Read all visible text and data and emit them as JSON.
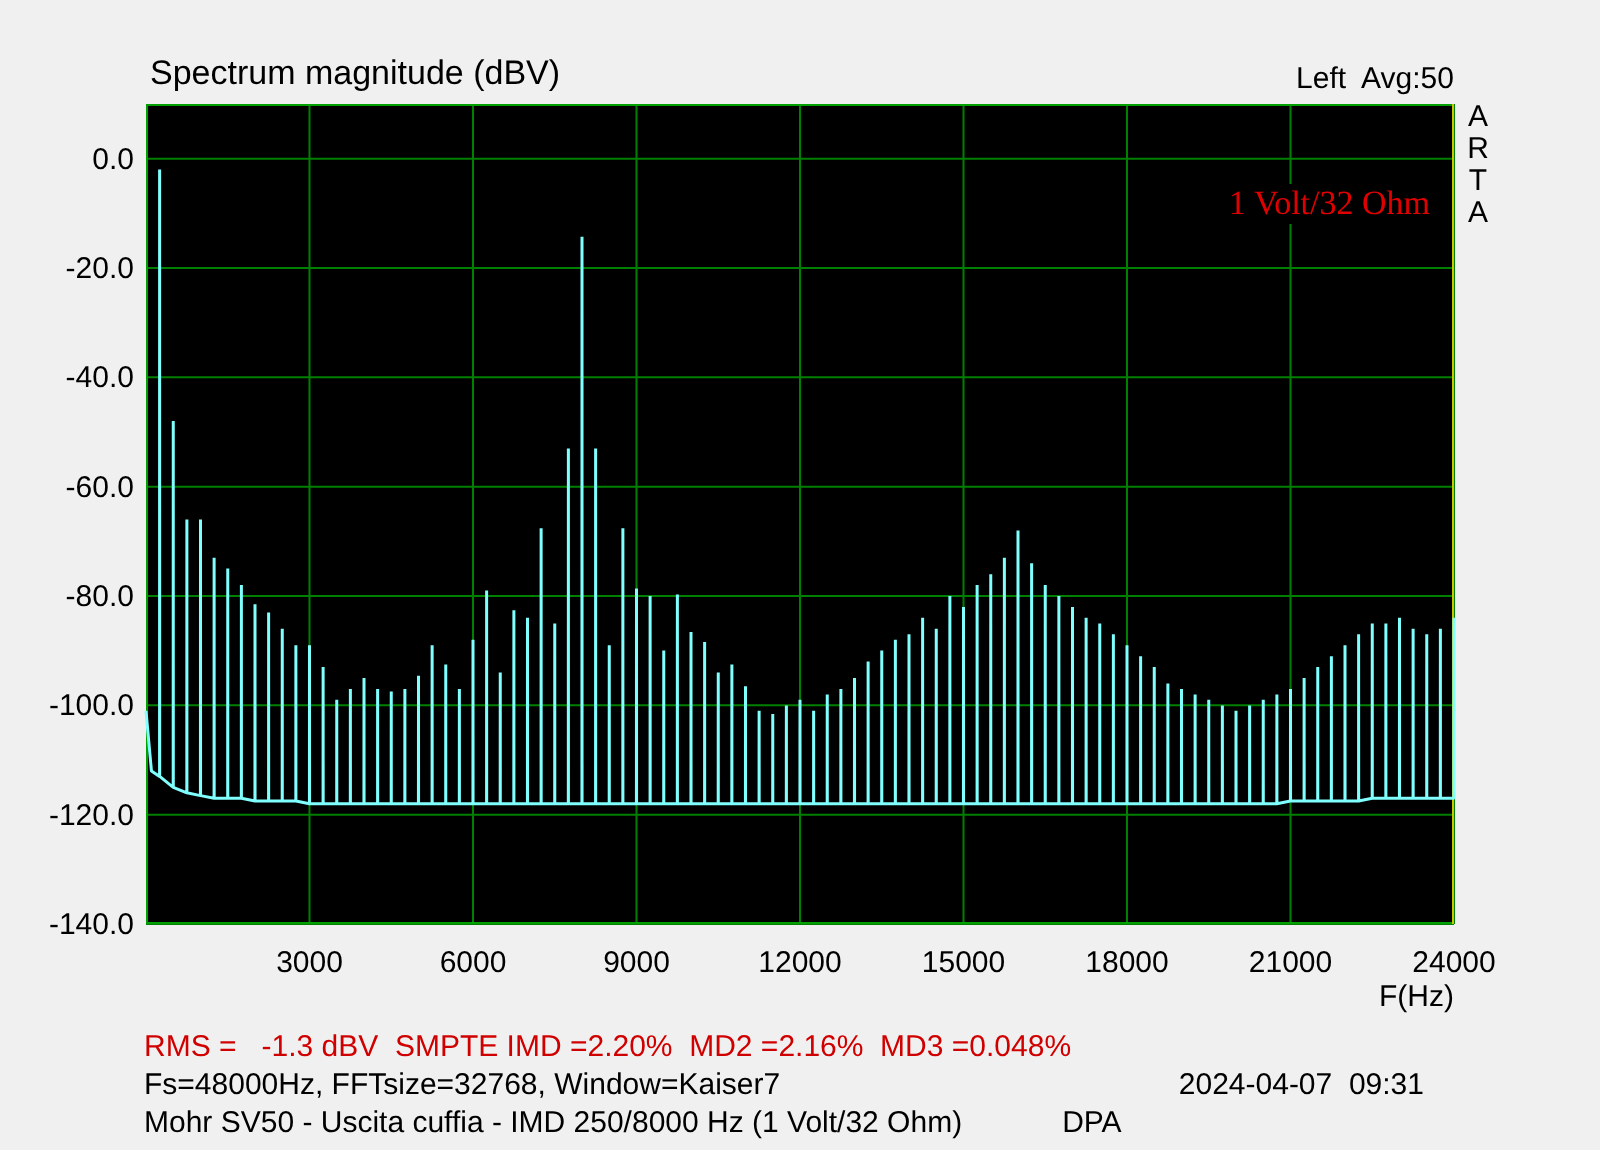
{
  "header": {
    "channel_info": "Left  Avg:50"
  },
  "chart_data": {
    "type": "line",
    "title": "Spectrum magnitude (dBV)",
    "xlabel": "F(Hz)",
    "grid": true,
    "x": [
      0,
      100,
      249,
      250,
      251,
      499,
      500,
      501,
      749,
      750,
      751,
      999,
      1000,
      1001,
      1249,
      1250,
      1251,
      1499,
      1500,
      1501,
      1749,
      1750,
      1751,
      1999,
      2000,
      2001,
      2249,
      2250,
      2251,
      2499,
      2500,
      2501,
      2749,
      2750,
      2751,
      2999,
      3000,
      3001,
      3249,
      3250,
      3251,
      3499,
      3500,
      3501,
      3749,
      3750,
      3751,
      3999,
      4000,
      4001,
      4249,
      4250,
      4251,
      4499,
      4500,
      4501,
      4749,
      4750,
      4751,
      4999,
      5000,
      5001,
      5249,
      5250,
      5251,
      5499,
      5500,
      5501,
      5749,
      5750,
      5751,
      5999,
      6000,
      6001,
      6249,
      6250,
      6251,
      6499,
      6500,
      6501,
      6749,
      6750,
      6751,
      6999,
      7000,
      7001,
      7249,
      7250,
      7251,
      7499,
      7500,
      7501,
      7749,
      7750,
      7751,
      7999,
      8000,
      8001,
      8249,
      8250,
      8251,
      8499,
      8500,
      8501,
      8749,
      8750,
      8751,
      8999,
      9000,
      9001,
      9249,
      9250,
      9251,
      9499,
      9500,
      9501,
      9749,
      9750,
      9751,
      9999,
      10000,
      10001,
      10249,
      10250,
      10251,
      10499,
      10500,
      10501,
      10749,
      10750,
      10751,
      10999,
      11000,
      11001,
      11249,
      11250,
      11251,
      11499,
      11500,
      11501,
      11749,
      11750,
      11751,
      11999,
      12000,
      12001,
      12249,
      12250,
      12251,
      12499,
      12500,
      12501,
      12749,
      12750,
      12751,
      12999,
      13000,
      13001,
      13249,
      13250,
      13251,
      13499,
      13500,
      13501,
      13749,
      13750,
      13751,
      13999,
      14000,
      14001,
      14249,
      14250,
      14251,
      14499,
      14500,
      14501,
      14749,
      14750,
      14751,
      14999,
      15000,
      15001,
      15249,
      15250,
      15251,
      15499,
      15500,
      15501,
      15749,
      15750,
      15751,
      15999,
      16000,
      16001,
      16249,
      16250,
      16251,
      16499,
      16500,
      16501,
      16749,
      16750,
      16751,
      16999,
      17000,
      17001,
      17249,
      17250,
      17251,
      17499,
      17500,
      17501,
      17749,
      17750,
      17751,
      17999,
      18000,
      18001,
      18249,
      18250,
      18251,
      18499,
      18500,
      18501,
      18749,
      18750,
      18751,
      18999,
      19000,
      19001,
      19249,
      19250,
      19251,
      19499,
      19500,
      19501,
      19749,
      19750,
      19751,
      19999,
      20000,
      20001,
      20249,
      20250,
      20251,
      20499,
      20500,
      20501,
      20749,
      20750,
      20751,
      20999,
      21000,
      21001,
      21249,
      21250,
      21251,
      21499,
      21500,
      21501,
      21749,
      21750,
      21751,
      21999,
      22000,
      22001,
      22249,
      22250,
      22251,
      22499,
      22500,
      22501,
      22749,
      22750,
      22751,
      22999,
      23000,
      23001,
      23249,
      23250,
      23251,
      23499,
      23500,
      23501,
      23749,
      23750,
      23751,
      23999,
      24000
    ],
    "series": [
      {
        "color": "#80ffff",
        "values": [
          -101,
          -112,
          -113,
          -2,
          -113,
          -115,
          -48,
          -115,
          -116,
          -66,
          -116,
          -116.5,
          -66,
          -116.5,
          -117,
          -73,
          -117,
          -117,
          -75,
          -117,
          -117,
          -78,
          -117,
          -117.5,
          -81.5,
          -117.5,
          -117.5,
          -83,
          -117.5,
          -117.5,
          -86,
          -117.5,
          -117.5,
          -89,
          -117.5,
          -118,
          -89,
          -118,
          -118,
          -93,
          -118,
          -118,
          -99,
          -118,
          -118,
          -97,
          -118,
          -118,
          -95,
          -118,
          -118,
          -97,
          -118,
          -118,
          -97.5,
          -118,
          -118,
          -97,
          -118,
          -118,
          -94.6,
          -118,
          -118,
          -89,
          -118,
          -118,
          -92.5,
          -118,
          -118,
          -97,
          -118,
          -118,
          -88,
          -118,
          -118,
          -79,
          -118,
          -118,
          -94,
          -118,
          -118,
          -82.6,
          -118,
          -118,
          -84,
          -118,
          -118,
          -67.6,
          -118,
          -118,
          -85,
          -118,
          -118,
          -53,
          -118,
          -118,
          -14.3,
          -118,
          -118,
          -53,
          -118,
          -118,
          -89,
          -118,
          -118,
          -67.6,
          -118,
          -118,
          -78.6,
          -118,
          -118,
          -80,
          -118,
          -118,
          -90,
          -118,
          -118,
          -79.7,
          -118,
          -118,
          -86.6,
          -118,
          -118,
          -88.4,
          -118,
          -118,
          -94,
          -118,
          -118,
          -92.5,
          -118,
          -118,
          -96.5,
          -118,
          -118,
          -101,
          -118,
          -118,
          -101.6,
          -118,
          -118,
          -100,
          -118,
          -118,
          -99,
          -118,
          -118,
          -101,
          -118,
          -118,
          -98,
          -118,
          -118,
          -97,
          -118,
          -118,
          -95,
          -118,
          -118,
          -92,
          -118,
          -118,
          -90,
          -118,
          -118,
          -88,
          -118,
          -118,
          -87,
          -118,
          -118,
          -84,
          -118,
          -118,
          -86,
          -118,
          -118,
          -80,
          -118,
          -118,
          -82,
          -118,
          -118,
          -78,
          -118,
          -118,
          -76,
          -118,
          -118,
          -73,
          -118,
          -118,
          -68,
          -118,
          -118,
          -74,
          -118,
          -118,
          -78,
          -118,
          -118,
          -80,
          -118,
          -118,
          -82,
          -118,
          -118,
          -84,
          -118,
          -118,
          -85,
          -118,
          -118,
          -87,
          -118,
          -118,
          -89,
          -118,
          -118,
          -91,
          -118,
          -118,
          -93,
          -118,
          -118,
          -96,
          -118,
          -118,
          -97,
          -118,
          -118,
          -98,
          -118,
          -118,
          -99,
          -118,
          -118,
          -100,
          -118,
          -118,
          -101,
          -118,
          -118,
          -100,
          -118,
          -118,
          -99,
          -118,
          -118,
          -98,
          -118,
          -117.5,
          -97,
          -117.5,
          -117.5,
          -95,
          -117.5,
          -117.5,
          -93,
          -117.5,
          -117.5,
          -91,
          -117.5,
          -117.5,
          -89,
          -117.5,
          -117.5,
          -87,
          -117.5,
          -117,
          -85,
          -117,
          -117,
          -85,
          -117,
          -117,
          -84,
          -117,
          -117,
          -86,
          -117,
          -117,
          -87,
          -117,
          -117,
          -86,
          -117,
          -117,
          -84
        ]
      }
    ],
    "xlim": [
      0,
      24000
    ],
    "ylim": [
      -140,
      10
    ],
    "xticks": [
      3000,
      6000,
      9000,
      12000,
      15000,
      18000,
      21000,
      24000
    ],
    "yticks": [
      {
        "value": 0,
        "label": "0.0"
      },
      {
        "value": -20,
        "label": "-20.0"
      },
      {
        "value": -40,
        "label": "-40.0"
      },
      {
        "value": -60,
        "label": "-60.0"
      },
      {
        "value": -80,
        "label": "-80.0"
      },
      {
        "value": -100,
        "label": "-100.0"
      },
      {
        "value": -120,
        "label": "-120.0"
      },
      {
        "value": -140,
        "label": "-140.0"
      }
    ],
    "annotations": [
      "1 Volt/32 Ohm"
    ]
  },
  "side_label": "ARTA",
  "footer": {
    "measurements": "RMS =   -1.3 dBV  SMPTE IMD =2.20%  MD2 =2.16%  MD3 =0.048%",
    "settings": "Fs=48000Hz, FFTsize=32768, Window=Kaiser7",
    "timestamp": "2024-04-07  09:31",
    "description": "Mohr SV50 - Uscita cuffia - IMD 250/8000 Hz (1 Volt/32 Ohm)",
    "author": "DPA"
  }
}
